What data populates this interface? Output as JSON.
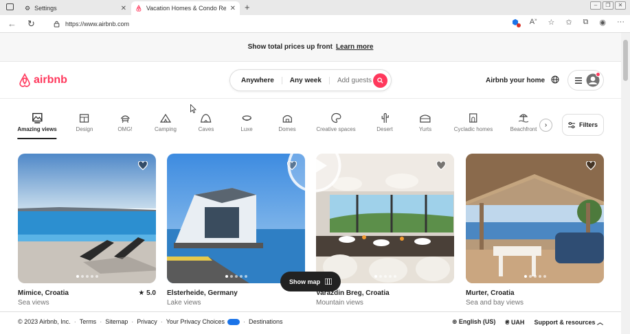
{
  "browser": {
    "tabs": [
      {
        "title": "Settings",
        "active": false
      },
      {
        "title": "Vacation Homes & Condo Rentals",
        "active": true
      }
    ],
    "url": "https://www.airbnb.com",
    "notification_count": "5"
  },
  "promo": {
    "text": "Show total prices up front",
    "link": "Learn more"
  },
  "header": {
    "logo": "airbnb",
    "search": {
      "where": "Anywhere",
      "when": "Any week",
      "guests": "Add guests"
    },
    "host_link": "Airbnb your home"
  },
  "categories": [
    {
      "label": "Amazing views",
      "icon": "amazing-views-icon",
      "active": true
    },
    {
      "label": "Design",
      "icon": "design-icon"
    },
    {
      "label": "OMG!",
      "icon": "omg-icon"
    },
    {
      "label": "Camping",
      "icon": "camping-icon"
    },
    {
      "label": "Caves",
      "icon": "caves-icon"
    },
    {
      "label": "Luxe",
      "icon": "luxe-icon"
    },
    {
      "label": "Domes",
      "icon": "domes-icon"
    },
    {
      "label": "Creative spaces",
      "icon": "creative-spaces-icon"
    },
    {
      "label": "Desert",
      "icon": "desert-icon"
    },
    {
      "label": "Yurts",
      "icon": "yurts-icon"
    },
    {
      "label": "Cycladic homes",
      "icon": "cycladic-homes-icon"
    },
    {
      "label": "Beachfront",
      "icon": "beachfront-icon"
    }
  ],
  "filters_label": "Filters",
  "listings": [
    {
      "title": "Mimice, Croatia",
      "subtitle": "Sea views",
      "rating": "5.0"
    },
    {
      "title": "Elsterheide, Germany",
      "subtitle": "Lake views"
    },
    {
      "title": "Varazdin Breg, Croatia",
      "subtitle": "Mountain views"
    },
    {
      "title": "Murter, Croatia",
      "subtitle": "Sea and bay views"
    }
  ],
  "show_map_label": "Show map",
  "footer": {
    "copyright": "© 2023 Airbnb, Inc.",
    "links": [
      "Terms",
      "Sitemap",
      "Privacy",
      "Your Privacy Choices",
      "Destinations"
    ],
    "language": "English (US)",
    "currency": "UAH",
    "support": "Support & resources"
  },
  "colors": {
    "brand": "#ff385c",
    "text": "#222222",
    "muted": "#717171"
  }
}
